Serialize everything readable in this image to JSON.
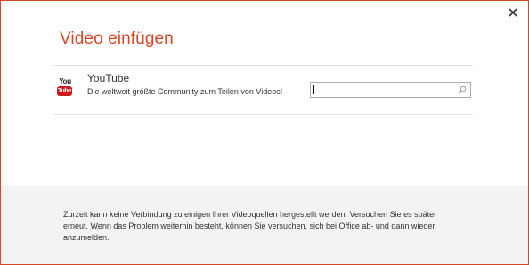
{
  "dialog": {
    "title": "Video einfügen",
    "close_label": "×"
  },
  "sources": [
    {
      "icon": "youtube-icon",
      "icon_text_top": "You",
      "icon_text_bottom": "Tube",
      "name": "YouTube",
      "description": "Die weltweit größte Community zum Teilen von Videos!",
      "search": {
        "value": "",
        "placeholder": ""
      }
    }
  ],
  "footer": {
    "message": "Zurzeit kann keine Verbindung zu einigen Ihrer Videoquellen hergestellt werden. Versuchen Sie es später erneut. Wenn das Problem weiterhin besteht, können Sie versuchen, sich bei Office ab- und dann wieder anzumelden."
  },
  "colors": {
    "accent": "#d24726",
    "border": "#d24726",
    "footer_bg": "#f3f3f3",
    "youtube_red": "#cc181e"
  }
}
